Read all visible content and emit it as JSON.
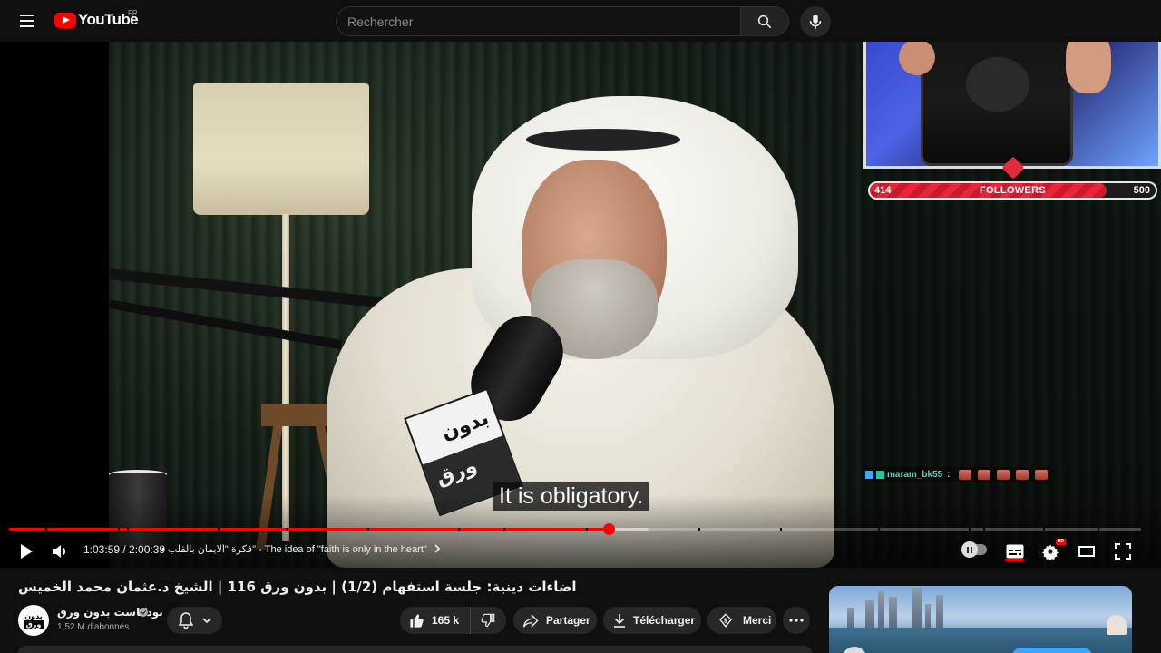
{
  "header": {
    "logo_text": "YouTube",
    "country_code": "FR",
    "search_placeholder": "Rechercher"
  },
  "player": {
    "subtitle": "It is obligatory.",
    "current_time": "1:03:59",
    "duration": "2:00:39",
    "time_display": "1:03:59 / 2:00:39",
    "chapter_title": "فكرة \"الايمان بالقلب\" - The idea of \"faith is only in the heart\"",
    "chapter_separator": "•",
    "progress_played": 0.53,
    "progress_buffered": 0.565,
    "hd_badge": "HD",
    "mic_flag_top": "بدون",
    "mic_flag_bottom": "ورق"
  },
  "overlay": {
    "followers_current": "414",
    "followers_label": "FOLLOWERS",
    "followers_goal": "500",
    "followers_fraction": 0.828,
    "chat_user": "maram_bk55",
    "chat_colon": ":"
  },
  "video": {
    "title": "اضاءات دينية: جلسة استفهام (1/2) | بدون ورق 116 | الشيخ د.عثمان محمد الخميس",
    "channel_name": "بودكاست بدون ورق",
    "channel_avatar_top": "بدون",
    "channel_avatar_bottom": "ورق",
    "subscribers": "1,52 M d'abonnés",
    "likes": "165 k",
    "share_label": "Partager",
    "download_label": "Télécharger",
    "thanks_label": "Merci"
  },
  "colors": {
    "accent": "#ff0000",
    "background": "#0f0f0f",
    "pill": "#272727",
    "followers_bar": "#e8263a",
    "chat_name": "#5fd3c7"
  },
  "icons": {
    "menu": "hamburger-menu-icon",
    "search": "search-icon",
    "mic": "microphone-icon",
    "play": "play-icon",
    "volume": "volume-icon",
    "captions": "subtitles-icon",
    "settings": "gear-icon",
    "theater": "theater-mode-icon",
    "fullscreen": "fullscreen-icon",
    "like": "thumbs-up-icon",
    "dislike": "thumbs-down-icon",
    "share": "share-arrow-icon",
    "download": "download-icon",
    "thanks": "super-thanks-icon",
    "more": "more-horizontal-icon",
    "bell": "bell-icon"
  }
}
